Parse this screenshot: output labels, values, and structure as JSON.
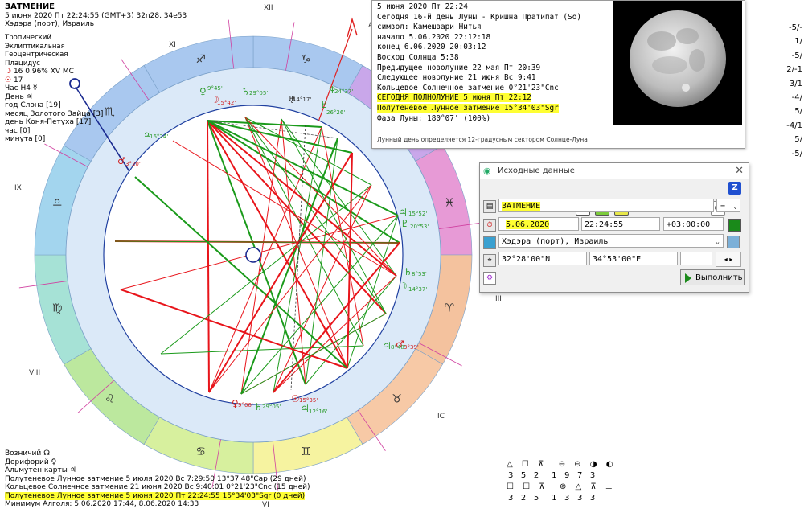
{
  "header": {
    "title": "ЗАТМЕНИЕ",
    "datetime_line": "5 июня 2020  Пт  22:24:55 (GMT+3) 32n28, 34e53",
    "location_line": "Хэдэра (порт), Израиль"
  },
  "left_info": {
    "lines": [
      "Тропический",
      "Эклиптикальная",
      "Геоцентрическая",
      "Плацидус"
    ],
    "moon_phase": "16 0.96% XV",
    "mc_label": "MC",
    "sun_line": "17",
    "hour_line": "Час H4",
    "day_line": "День",
    "year_line": "год Слона [19]",
    "month_line": "месяц Золотого Зайца [3]",
    "day_animal_line": "день Коня-Петуха [17]",
    "hour_animal_line": "час [0]",
    "minute_line": "минута [0]"
  },
  "chart": {
    "house_labels": {
      "XII": "XII",
      "XI": "XI",
      "IX": "IX",
      "VIII": "VIII",
      "VI": "VI",
      "III": "III",
      "IC": "IC",
      "AS": "AS"
    },
    "degree_labels": [
      {
        "id": "ven",
        "text": "9°45'"
      },
      {
        "id": "moon-top",
        "text": "15°42'"
      },
      {
        "id": "sat",
        "text": "29°05'"
      },
      {
        "id": "ura",
        "text": "14°17'"
      },
      {
        "id": "nep",
        "text": "24°37'"
      },
      {
        "id": "plu",
        "text": "26°26'"
      },
      {
        "id": "jup",
        "text": "16°24'"
      },
      {
        "id": "mars",
        "text": "3°20'"
      },
      {
        "id": "r1",
        "text": "15°52'"
      },
      {
        "id": "r2",
        "text": "20°53'"
      },
      {
        "id": "r3",
        "text": "8°53'"
      },
      {
        "id": "r4",
        "text": "14°37'"
      },
      {
        "id": "r5",
        "text": "8°48'"
      },
      {
        "id": "r6",
        "text": "3°39'"
      },
      {
        "id": "b1",
        "text": "9°06'"
      },
      {
        "id": "b2",
        "text": "29°05'"
      },
      {
        "id": "b3",
        "text": "15°35'"
      },
      {
        "id": "b4",
        "text": "12°16'"
      }
    ]
  },
  "moon_popup": {
    "lines": [
      "5 июня 2020 Пт    22:24",
      "Сегодня 16-й день Луны - Кришна Пратипат (So)",
      "  символ: Камешвари Нитья",
      "  начало   5.06.2020 22:12:18",
      "  конец  6.06.2020 20:03:12",
      "Восход Солнца 5:38",
      "Предыдущее новолуние 22 мая Пт 20:39",
      "Следующее новолуние 21 июня Вс   9:41",
      " Кольцевое Солнечное затмение  0°21'23\"Cnc"
    ],
    "highlight_lines": [
      "СЕГОДНЯ ПОЛНОЛУНИЕ 5 июня Пт 22:12",
      " Полутеневое Лунное затмение 15°34'03\"Sgr"
    ],
    "phase_line": "Фаза Луны: 180°07' (100%)",
    "footnote": "Лунный день определяется 12-градусным сектором Солнце-Луна"
  },
  "dialog": {
    "title": "Исходные данные",
    "close": "✕",
    "name_value": "ЗАТМЕНИЕ",
    "name_sign": "−",
    "date_value": "5.06.2020",
    "time_value": "22:24:55",
    "tz_value": "+03:00:00",
    "place_value": "Хэдэра (порт), Израиль",
    "lat_value": "32°28'00\"N",
    "lon_value": "34°53'00\"E",
    "run_button": "Выполнить",
    "toolbar": [
      "K",
      "L",
      "H"
    ]
  },
  "right_edge": {
    "values": [
      "-5/-",
      "1/",
      "-5/",
      "2/-1",
      "3/1",
      "-4/",
      "5/",
      "-4/1",
      "5/",
      "-5/"
    ]
  },
  "bottom_info": {
    "lines": [
      "Возничий",
      "Дорифорий",
      "Альмутен карты",
      "Полутеневое Лунное затмение 5 июля 2020 Вс  7:29:50 13°37'48\"Cap (29 дней)",
      "Кольцевое Солнечное затмение 21 июня 2020 Вс  9:40:01  0°21'23\"Cnc (15 дней)"
    ],
    "highlight_line": "Полутеневое Лунное затмение 5 июня 2020 Пт 22:24:55 15°34'03\"Sgr (0 дней)",
    "last_line": "Минимум Алголя: 5.06.2020 17:44,  8.06.2020 14:33"
  },
  "aspect_panel": {
    "row1": [
      "3",
      "5",
      "2",
      "1",
      "9",
      "7",
      "3"
    ],
    "row2": [
      "3",
      "2",
      "5",
      "1",
      "3",
      "3",
      "3"
    ]
  },
  "colors": {
    "zodiac_blue": "#9fc3ec",
    "zodiac_purple": "#c9a8e8",
    "zodiac_pink": "#e79ad6",
    "zodiac_peach": "#f4c29a",
    "zodiac_yellow": "#f4f49a",
    "zodiac_green": "#b9e69a",
    "zodiac_teal": "#9ee0d4",
    "highlight": "#ffff33",
    "aspect_red": "#e8141a",
    "aspect_green": "#1a9a1a"
  }
}
